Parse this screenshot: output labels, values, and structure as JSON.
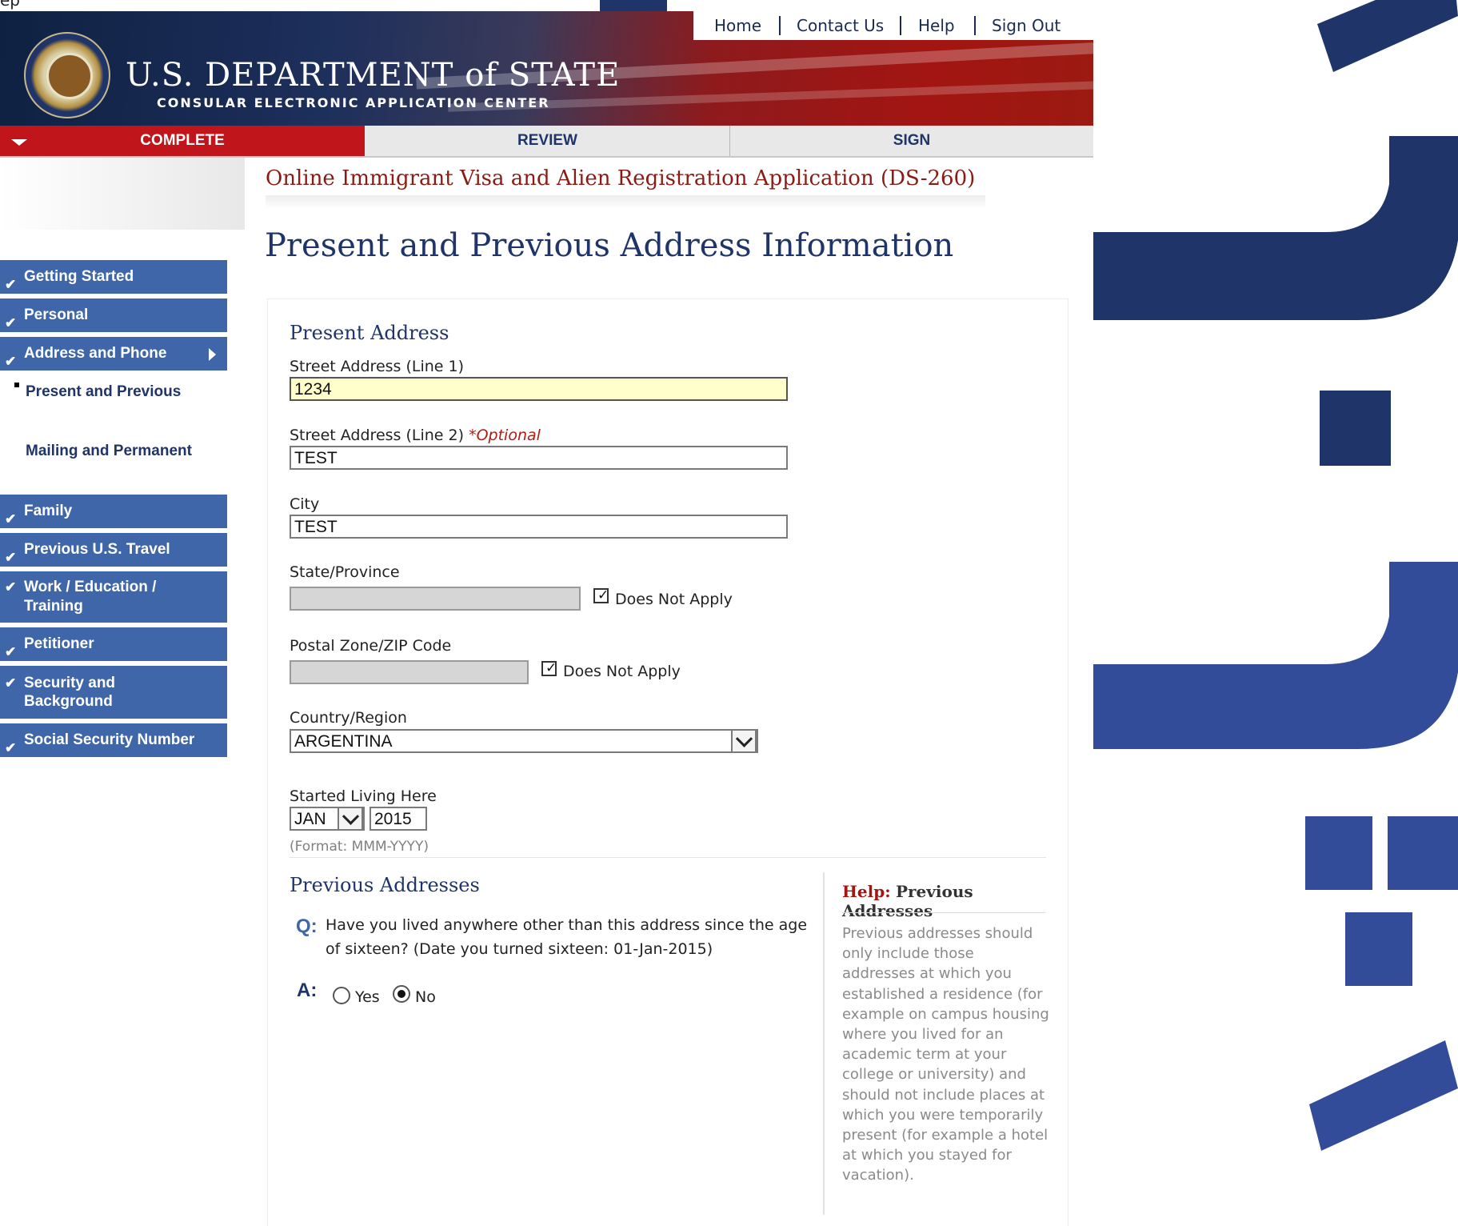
{
  "topbar": {
    "fragment": "ep"
  },
  "util_nav": [
    "Home",
    "Contact Us",
    "Help",
    "Sign Out"
  ],
  "brand": {
    "title": "U.S. DEPARTMENT of STATE",
    "subtitle": "CONSULAR ELECTRONIC APPLICATION CENTER"
  },
  "tabs": {
    "complete": "COMPLETE",
    "review": "REVIEW",
    "sign": "SIGN"
  },
  "sidebar": {
    "items": [
      "Getting Started",
      "Personal",
      "Address and Phone",
      "Family",
      "Previous U.S. Travel",
      "Work / Education / Training",
      "Petitioner",
      "Security and Background",
      "Social Security Number"
    ],
    "sub_items": [
      "Present and Previous",
      "Mailing and Permanent"
    ],
    "check": "✔"
  },
  "form": {
    "title": "Online Immigrant Visa and Alien Registration Application (DS-260)",
    "heading": "Present and Previous Address Information"
  },
  "present": {
    "section": "Present Address",
    "street1_label": "Street Address (Line 1)",
    "street1_value": "1234",
    "street2_label": "Street Address (Line 2)",
    "optional": "*Optional",
    "street2_value": "TEST",
    "city_label": "City",
    "city_value": "TEST",
    "state_label": "State/Province",
    "does_not_apply": "Does Not Apply",
    "zip_label": "Postal Zone/ZIP Code",
    "country_label": "Country/Region",
    "country_value": "ARGENTINA",
    "started_label": "Started Living Here",
    "month_value": "JAN",
    "year_value": "2015",
    "format_hint": "(Format: MMM-YYYY)"
  },
  "previous": {
    "section": "Previous Addresses",
    "q_mark": "Q:",
    "question": "Have you lived anywhere other than this address since the age of sixteen? (Date you turned sixteen: 01-Jan-2015)",
    "a_mark": "A:",
    "yes": "Yes",
    "no": "No",
    "selected": "No"
  },
  "help": {
    "label": "Help:",
    "topic": "Previous Addresses",
    "text": "Previous addresses should only include those addresses at which you established a residence (for example on campus housing where you lived for an academic term at your college or university) and should not include places at which you were temporarily present (for example a hotel at which you stayed for vacation)."
  },
  "colors": {
    "primary_blue": "#3f66a8",
    "navy": "#1f3468",
    "accent_red": "#c0151b",
    "highlight_yellow": "#ffffcc"
  }
}
